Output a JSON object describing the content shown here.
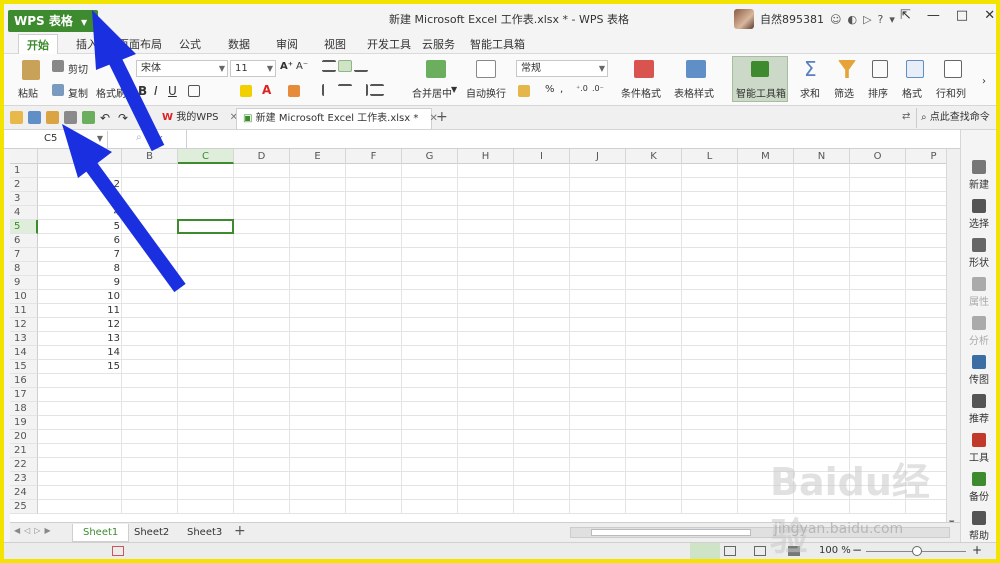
{
  "app": {
    "menu_button": "WPS 表格",
    "window_title": "新建 Microsoft Excel 工作表.xlsx * - WPS 表格",
    "user_name": "自然895381"
  },
  "ribbon_tabs": [
    "开始",
    "插入",
    "页面布局",
    "公式",
    "数据",
    "审阅",
    "视图",
    "开发工具",
    "云服务",
    "智能工具箱"
  ],
  "ribbon": {
    "paste": "粘贴",
    "cut": "剪切",
    "copy": "复制",
    "format_painter": "格式刷",
    "font_name": "宋体",
    "font_size": "11",
    "merge_center": "合并居中",
    "wrap_text": "自动换行",
    "number_format": "常规",
    "conditional_format": "条件格式",
    "table_style": "表格样式",
    "smart_toolbox": "智能工具箱",
    "sum": "求和",
    "filter": "筛选",
    "sort": "排序",
    "format": "格式",
    "rows_cols": "行和列",
    "bold": "B",
    "italic": "I",
    "underline": "U",
    "percent": "%"
  },
  "quick_access": {
    "tab_mywps": "我的WPS",
    "tab_workbook": "新建 Microsoft Excel 工作表.xlsx *",
    "search_command": "点此查找命令"
  },
  "formula_bar": {
    "name_box": "C5",
    "fx": "fx"
  },
  "grid": {
    "columns": [
      "A",
      "B",
      "C",
      "D",
      "E",
      "F",
      "G",
      "H",
      "I",
      "J",
      "K",
      "L",
      "M",
      "N",
      "O",
      "P"
    ],
    "rows": [
      "1",
      "2",
      "3",
      "4",
      "5",
      "6",
      "7",
      "8",
      "9",
      "10",
      "11",
      "12",
      "13",
      "14",
      "15",
      "16",
      "17",
      "18",
      "19",
      "20",
      "21",
      "22",
      "23",
      "24",
      "25"
    ],
    "selected_cell": "C5",
    "column_a_values": [
      "",
      "2",
      "3",
      "4",
      "5",
      "6",
      "7",
      "8",
      "9",
      "10",
      "11",
      "12",
      "13",
      "14",
      "15"
    ]
  },
  "sheets": [
    "Sheet1",
    "Sheet2",
    "Sheet3"
  ],
  "active_sheet": "Sheet1",
  "status": {
    "zoom": "100 %"
  },
  "side_panel": [
    "新建",
    "选择",
    "形状",
    "属性",
    "分析",
    "传图",
    "推荐",
    "工具",
    "备份",
    "帮助"
  ],
  "watermark": {
    "brand": "Baidu经验",
    "url": "jingyan.baidu.com"
  },
  "colors": {
    "accent": "#3d8b2e",
    "arrow": "#1a2fe0",
    "frame": "#f2e400"
  }
}
